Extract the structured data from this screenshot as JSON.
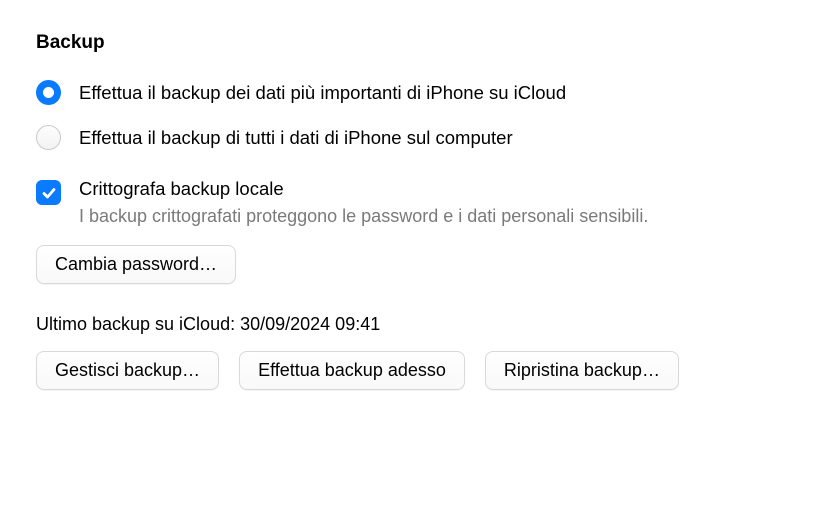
{
  "section": {
    "title": "Backup"
  },
  "radios": {
    "icloud": "Effettua il backup dei dati più importanti di iPhone su iCloud",
    "computer": "Effettua il backup di tutti i dati di iPhone sul computer"
  },
  "encrypt": {
    "label": "Crittografa backup locale",
    "desc": "I backup crittografati proteggono le password e i dati personali sensibili."
  },
  "buttons": {
    "change_password": "Cambia password…",
    "manage": "Gestisci backup…",
    "backup_now": "Effettua backup adesso",
    "restore": "Ripristina backup…"
  },
  "status": {
    "last_backup": "Ultimo backup su iCloud: 30/09/2024 09:41"
  }
}
